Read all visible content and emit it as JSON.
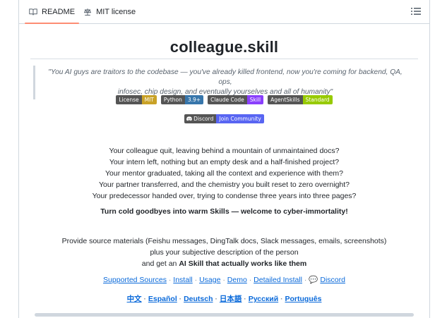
{
  "tabs": [
    {
      "label": "README",
      "icon": "book-icon",
      "active": true
    },
    {
      "label": "MIT license",
      "icon": "scale-icon",
      "active": false
    }
  ],
  "title": "colleague.skill",
  "quote_line1": "\"You AI guys are traitors to the codebase — you've already killed frontend, now you're coming for backend, QA, ops,",
  "quote_line2": "infosec, chip design, and eventually yourselves and all of humanity\"",
  "badges": [
    {
      "left": "License",
      "right": "MIT",
      "color": "#dfb317"
    },
    {
      "left": "Python",
      "right": "3.9+",
      "color": "#3776ab"
    },
    {
      "left": "Claude Code",
      "right": "Skill",
      "color": "#8a3ffc"
    },
    {
      "left": "AgentSkills",
      "right": "Standard",
      "color": "#97ca00"
    }
  ],
  "discord_badge": {
    "left": "Discord",
    "right": "Join Community",
    "color": "#5865F2"
  },
  "intro_lines": [
    "Your colleague quit, leaving behind a mountain of unmaintained docs?",
    "Your intern left, nothing but an empty desk and a half-finished project?",
    "Your mentor graduated, taking all the context and experience with them?",
    "Your partner transferred, and the chemistry you built reset to zero overnight?",
    "Your predecessor handed over, trying to condense three years into three pages?"
  ],
  "tagline": "Turn cold goodbyes into warm Skills — welcome to cyber-immortality!",
  "desc_line1": "Provide source materials (Feishu messages, DingTalk docs, Slack messages, emails, screenshots)",
  "desc_line2": "plus your subjective description of the person",
  "desc_line3_prefix": "and get an ",
  "desc_line3_bold": "AI Skill that actually works like them",
  "links": [
    "Supported Sources",
    "Install",
    "Usage",
    "Demo",
    "Detailed Install",
    "Discord"
  ],
  "separator": " · ",
  "languages": [
    "中文",
    "Español",
    "Deutsch",
    "日本語",
    "Русский",
    "Português"
  ]
}
